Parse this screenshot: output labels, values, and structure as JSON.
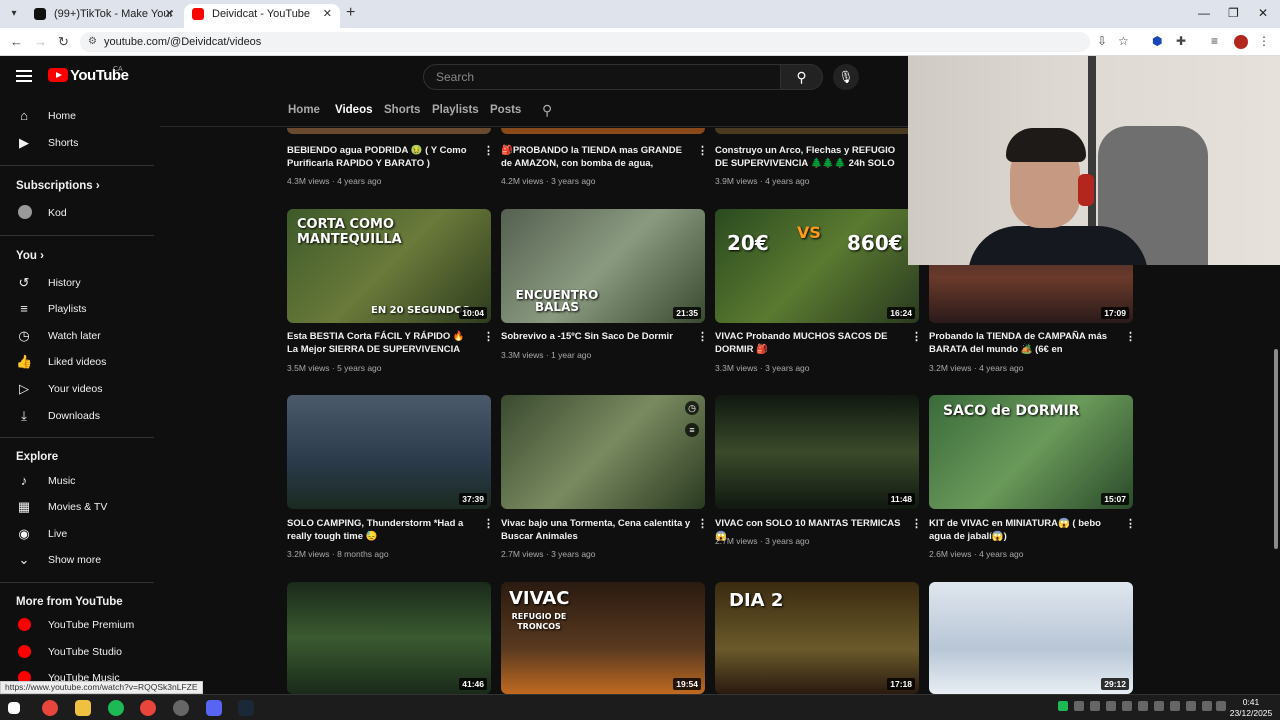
{
  "browser": {
    "tabs": [
      {
        "title": "(99+)TikTok - Make Your Day"
      },
      {
        "title": "Deividcat - YouTube"
      }
    ],
    "url": "youtube.com/@Deividcat/videos",
    "status_url": "https://www.youtube.com/watch?v=RQQSk3nLFZE"
  },
  "masthead": {
    "logo_text": "YouTube",
    "country": "CA",
    "search_placeholder": "Search"
  },
  "sidebar": {
    "main": [
      {
        "label": "Home",
        "icon": "home-icon"
      },
      {
        "label": "Shorts",
        "icon": "shorts-icon"
      }
    ],
    "subscriptions_heading": "Subscriptions",
    "subscriptions": [
      {
        "label": "Kod"
      }
    ],
    "you_heading": "You",
    "you": [
      {
        "label": "History",
        "icon": "history-icon"
      },
      {
        "label": "Playlists",
        "icon": "playlists-icon"
      },
      {
        "label": "Watch later",
        "icon": "clock-icon"
      },
      {
        "label": "Liked videos",
        "icon": "thumbs-up-icon"
      },
      {
        "label": "Your videos",
        "icon": "play-square-icon"
      },
      {
        "label": "Downloads",
        "icon": "download-icon"
      }
    ],
    "explore_heading": "Explore",
    "explore": [
      {
        "label": "Music",
        "icon": "music-icon"
      },
      {
        "label": "Movies & TV",
        "icon": "film-icon"
      },
      {
        "label": "Live",
        "icon": "live-icon"
      },
      {
        "label": "Show more",
        "icon": "chevron-down-icon"
      }
    ],
    "more_heading": "More from YouTube",
    "more": [
      {
        "label": "YouTube Premium"
      },
      {
        "label": "YouTube Studio"
      },
      {
        "label": "YouTube Music"
      }
    ]
  },
  "channel_tabs": [
    "Home",
    "Videos",
    "Shorts",
    "Playlists",
    "Posts"
  ],
  "videos": [
    {
      "title": "BEBIENDO agua PODRIDA 🤢 ( Y Como Purificarla RAPIDO Y BARATO )",
      "views": "4.3M views",
      "age": "4 years ago"
    },
    {
      "title": "🎒PROBANDO la TIENDA mas GRANDE de AMAZON, con bomba de agua, proyector,...",
      "views": "4.2M views",
      "age": "3 years ago"
    },
    {
      "title": "Construyo un Arco, Flechas y REFUGIO DE SUPERVIVENCIA 🌲🌲🌲 24h SOLO en el...",
      "views": "3.9M views",
      "age": "4 years ago"
    },
    {
      "title": "",
      "views": "",
      "age": ""
    },
    {
      "title": "Esta BESTIA Corta FÁCIL Y RÁPIDO 🔥 La Mejor SIERRA DE SUPERVIVENCIA",
      "views": "3.5M views",
      "age": "5 years ago",
      "duration": "10:04",
      "thumb_text": "CORTA COMO MANTEQUILLA",
      "thumb_text2": "EN 20 SEGUNDOS"
    },
    {
      "title": "Sobrevivo a -15ºC Sin Saco De Dormir",
      "views": "3.3M views",
      "age": "1 year ago",
      "duration": "21:35",
      "thumb_text": "ENCUENTRO BALAS"
    },
    {
      "title": "VIVAC Probando MUCHOS SACOS DE DORMIR 🎒",
      "views": "3.3M views",
      "age": "3 years ago",
      "duration": "16:24",
      "thumb_text": "20€",
      "thumb_text2": "VS",
      "thumb_text3": "860€"
    },
    {
      "title": "Probando la TIENDA de CAMPAÑA más BARATA del mundo 🏕️ (6€ en AliExpress)...",
      "views": "3.2M views",
      "age": "4 years ago",
      "duration": "17:09"
    },
    {
      "title": "SOLO CAMPING, Thunderstorm *Had a really tough time 😓",
      "views": "3.2M views",
      "age": "8 months ago",
      "duration": "37:39"
    },
    {
      "title": "Vivac bajo una Tormenta, Cena calentita y Buscar Animales",
      "views": "2.7M views",
      "age": "3 years ago"
    },
    {
      "title": "VIVAC con SOLO 10 MANTAS TERMICAS 😱",
      "views": "2.7M views",
      "age": "3 years ago",
      "duration": "11:48"
    },
    {
      "title": "KIT de VIVAC en MINIATURA😱 ( bebo agua de jabalí😱)",
      "views": "2.6M views",
      "age": "4 years ago",
      "duration": "15:07",
      "thumb_text": "SACO de DORMIR"
    },
    {
      "duration": "41:46"
    },
    {
      "duration": "19:54",
      "thumb_text": "VIVAC",
      "thumb_text2": "REFUGIO DE TRONCOS"
    },
    {
      "duration": "17:18",
      "thumb_text": "DIA 2"
    },
    {
      "duration": "29:12"
    }
  ],
  "taskbar": {
    "time": "0:41",
    "date": "23/12/2025"
  }
}
